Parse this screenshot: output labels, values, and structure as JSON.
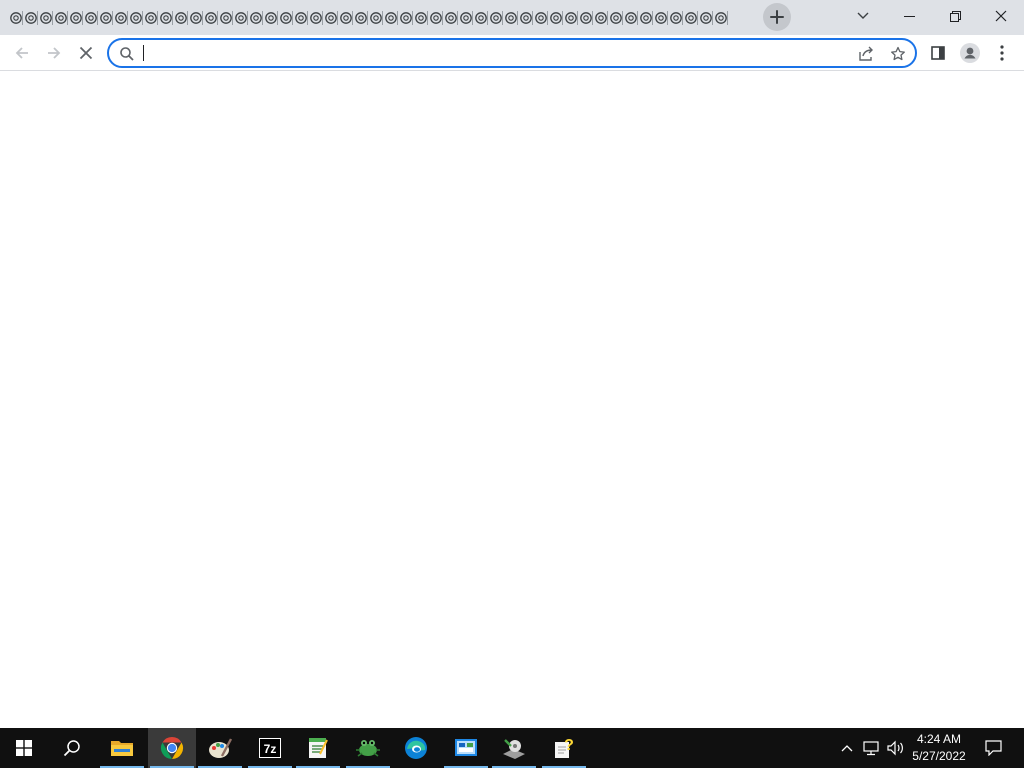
{
  "browser": {
    "tab_count": 48,
    "tab_favicon": "generic-page-icon",
    "new_tab_label": "New tab",
    "window_buttons": [
      "tab-search-icon",
      "minimize-icon",
      "restore-icon",
      "close-icon"
    ]
  },
  "toolbar": {
    "back": "back-icon",
    "forward": "forward-icon",
    "stop": "stop-icon",
    "omnibox": {
      "value": "",
      "placeholder": ""
    },
    "share": "share-icon",
    "bookmark": "star-icon",
    "side_panel": "side-panel-icon",
    "profile": "profile-icon",
    "menu": "menu-icon"
  },
  "taskbar": {
    "apps": [
      {
        "name": "File Explorer",
        "icon": "folder-icon",
        "running": true
      },
      {
        "name": "Google Chrome",
        "icon": "chrome-icon",
        "running": true,
        "active": true
      },
      {
        "name": "Paint",
        "icon": "paint-icon",
        "running": true
      },
      {
        "name": "7-Zip",
        "icon": "7zip-icon",
        "running": true
      },
      {
        "name": "Notepad",
        "icon": "notepad-icon",
        "running": true
      },
      {
        "name": "App",
        "icon": "frog-icon",
        "running": true
      },
      {
        "name": "Microsoft Edge",
        "icon": "edge-icon",
        "running": false
      },
      {
        "name": "Control Panel",
        "icon": "control-panel-icon",
        "running": true
      },
      {
        "name": "Setup",
        "icon": "setup-icon",
        "running": true
      },
      {
        "name": "Help",
        "icon": "help-icon",
        "running": true
      }
    ],
    "clock": {
      "time": "4:24 AM",
      "date": "5/27/2022"
    },
    "colors": {
      "taskbar_bg": "#101010",
      "accent": "#76b9ed",
      "focus_ring": "#1a73e8",
      "tabstrip_bg": "#dee1e6"
    }
  }
}
